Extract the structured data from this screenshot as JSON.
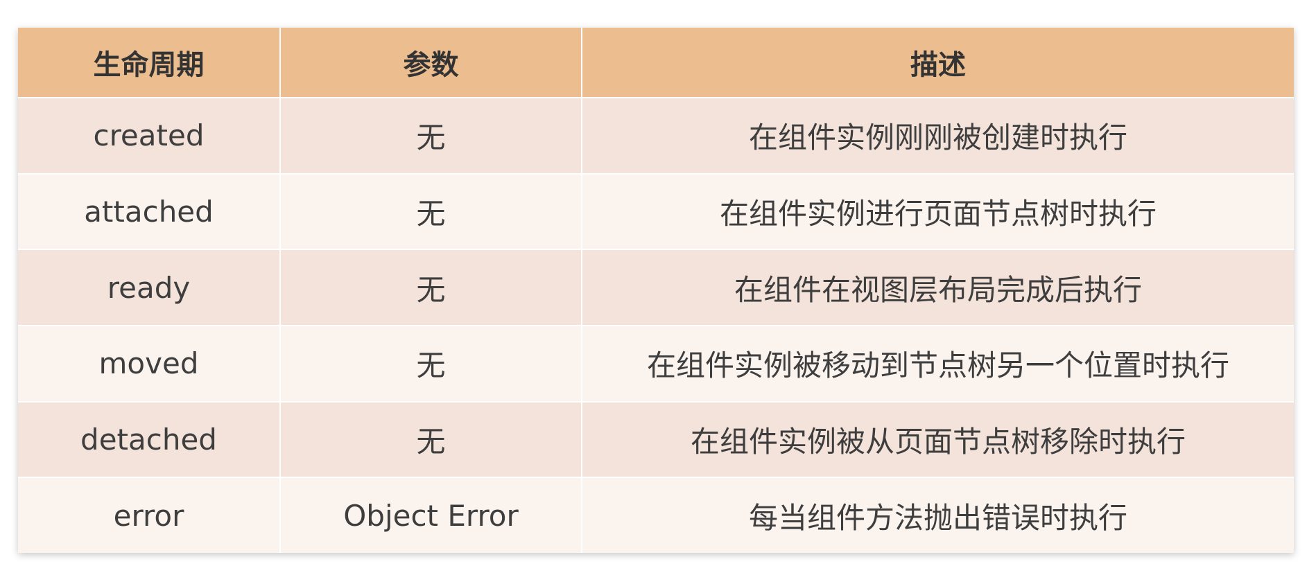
{
  "table": {
    "headers": [
      "生命周期",
      "参数",
      "描述"
    ],
    "rows": [
      [
        "created",
        "无",
        "在组件实例刚刚被创建时执行"
      ],
      [
        "attached",
        "无",
        "在组件实例进行页面节点树时执行"
      ],
      [
        "ready",
        "无",
        "在组件在视图层布局完成后执行"
      ],
      [
        "moved",
        "无",
        "在组件实例被移动到节点树另一个位置时执行"
      ],
      [
        "detached",
        "无",
        "在组件实例被从页面节点树移除时执行"
      ],
      [
        "error",
        "Object Error",
        "每当组件方法抛出错误时执行"
      ]
    ]
  },
  "colors": {
    "header_bg": "#ebbd8f",
    "row_odd_bg": "#f4e3da",
    "row_even_bg": "#fbf3ee",
    "text": "#3e3e3e"
  }
}
